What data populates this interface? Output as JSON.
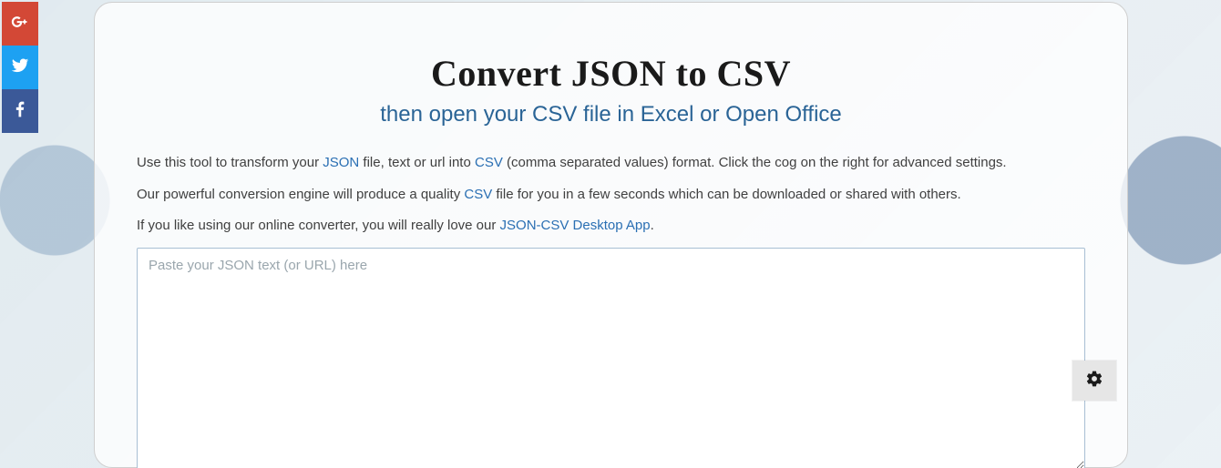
{
  "header": {
    "title": "Convert JSON to CSV",
    "subtitle": "then open your CSV file in Excel or Open Office"
  },
  "intro": {
    "p1_a": "Use this tool to transform your ",
    "p1_link1": "JSON",
    "p1_b": " file, text or url into ",
    "p1_link2": "CSV",
    "p1_c": " (comma separated values) format. Click the cog on the right for advanced settings.",
    "p2_a": "Our powerful conversion engine will produce a quality ",
    "p2_link1": "CSV",
    "p2_b": " file for you in a few seconds which can be downloaded or shared with others.",
    "p3_a": "If you like using our online converter, you will really love our ",
    "p3_link1": "JSON-CSV Desktop App",
    "p3_b": "."
  },
  "input": {
    "placeholder": "Paste your JSON text (or URL) here",
    "value": ""
  },
  "social": {
    "googleplus": "googleplus-icon",
    "twitter": "twitter-icon",
    "facebook": "facebook-icon"
  },
  "settings": {
    "icon": "gear-icon"
  }
}
